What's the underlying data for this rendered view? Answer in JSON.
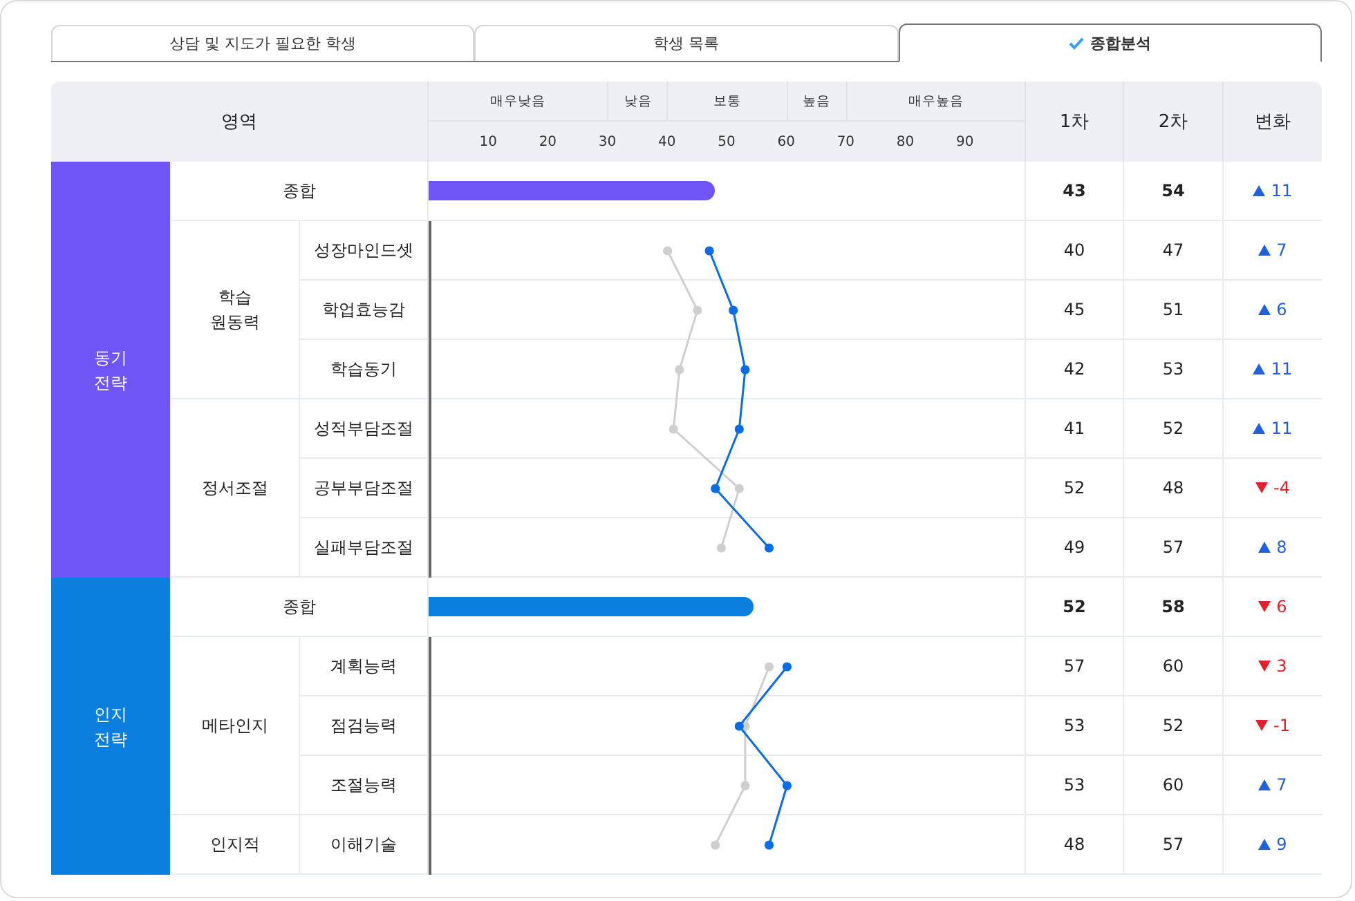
{
  "tabs": [
    {
      "label": "상담 및 지도가 필요한 학생",
      "selected": false
    },
    {
      "label": "학생 목록",
      "selected": false
    },
    {
      "label": "종합분석",
      "selected": true
    }
  ],
  "header": {
    "area": "영역",
    "bands": [
      "매우낮음",
      "낮음",
      "보통",
      "높음",
      "매우높음"
    ],
    "ticks": [
      "10",
      "20",
      "30",
      "40",
      "50",
      "60",
      "70",
      "80",
      "90"
    ],
    "columns": [
      "1차",
      "2차",
      "변화"
    ]
  },
  "domains": [
    {
      "label": "동기\n전략",
      "color": "#6f55f5",
      "summary": {
        "label": "종합",
        "level": 0.48,
        "first": "43",
        "second": "54",
        "change": {
          "rising": true,
          "value": "11"
        }
      },
      "groups": [
        {
          "label": "학습\n원동력",
          "items": [
            {
              "name": "성장마인드셋",
              "first": "40",
              "second": "47",
              "change": {
                "rising": true,
                "value": "7"
              }
            },
            {
              "name": "학업효능감",
              "first": "45",
              "second": "51",
              "change": {
                "rising": true,
                "value": "6"
              }
            },
            {
              "name": "학습동기",
              "first": "42",
              "second": "53",
              "change": {
                "rising": true,
                "value": "11"
              }
            }
          ]
        },
        {
          "label": "정서조절",
          "items": [
            {
              "name": "성적부담조절",
              "first": "41",
              "second": "52",
              "change": {
                "rising": true,
                "value": "11"
              }
            },
            {
              "name": "공부부담조절",
              "first": "52",
              "second": "48",
              "change": {
                "rising": false,
                "value": "-4"
              }
            },
            {
              "name": "실패부담조절",
              "first": "49",
              "second": "57",
              "change": {
                "rising": true,
                "value": "8"
              }
            }
          ]
        }
      ]
    },
    {
      "label": "인지\n전략",
      "color": "#0b7fe0",
      "summary": {
        "label": "종합",
        "level": 0.546,
        "first": "52",
        "second": "58",
        "change": {
          "rising": false,
          "value": "6"
        }
      },
      "groups": [
        {
          "label": "메타인지",
          "items": [
            {
              "name": "계획능력",
              "first": "57",
              "second": "60",
              "change": {
                "rising": false,
                "value": "3"
              }
            },
            {
              "name": "점검능력",
              "first": "53",
              "second": "52",
              "change": {
                "rising": false,
                "value": "-1"
              }
            },
            {
              "name": "조절능력",
              "first": "53",
              "second": "60",
              "change": {
                "rising": true,
                "value": "7"
              }
            }
          ]
        },
        {
          "label": "인지적",
          "items": [
            {
              "name": "이해기술",
              "first": "48",
              "second": "57",
              "change": {
                "rising": true,
                "value": "9"
              }
            }
          ]
        }
      ]
    }
  ]
}
